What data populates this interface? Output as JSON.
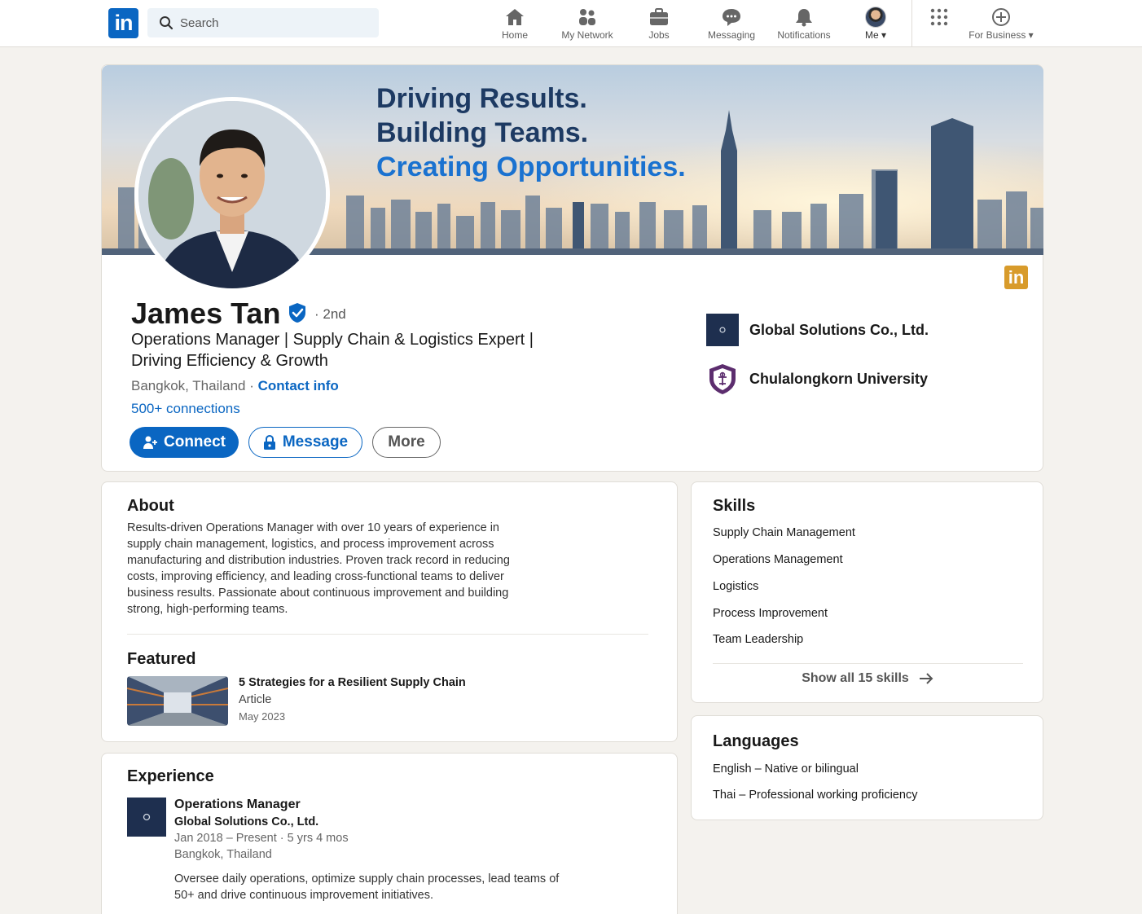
{
  "nav": {
    "logo": "in",
    "search_placeholder": "Search",
    "items": [
      {
        "label": "Home",
        "icon": "home-icon"
      },
      {
        "label": "My Network",
        "icon": "network-icon"
      },
      {
        "label": "Jobs",
        "icon": "briefcase-icon"
      },
      {
        "label": "Messaging",
        "icon": "messaging-icon"
      },
      {
        "label": "Notifications",
        "icon": "bell-icon"
      },
      {
        "label": "Me",
        "icon": "avatar"
      },
      {
        "label": "For Business",
        "icon": "grid-icon"
      }
    ],
    "accent": "#0a66c2"
  },
  "profile": {
    "banner_lines": [
      "Driving Results.",
      "Building Teams.",
      "Creating Opportunities."
    ],
    "name": "James Tan",
    "degree": "· 2nd",
    "headline": "Operations Manager | Supply Chain & Logistics Expert | Driving Efficiency & Growth",
    "location": "Bangkok, Thailand ·",
    "contact_info": "Contact info",
    "connections": "500+ connections",
    "buttons": {
      "connect": "Connect",
      "message": "Message",
      "more": "More"
    },
    "badge": "in",
    "badge_color": "#d89b2b",
    "company": "Global Solutions Co., Ltd.",
    "education": "Chulalongkorn University"
  },
  "about": {
    "title": "About",
    "text": "Results-driven Operations Manager with over 10 years of experience in supply chain management, logistics, and process improvement across manufacturing and distribution industries. Proven track record in reducing costs, improving efficiency, and leading cross-functional teams to deliver business results. Passionate about continuous improvement and building strong, high-performing teams."
  },
  "featured": {
    "title": "Featured",
    "item_title": "5 Strategies for a Resilient Supply Chain",
    "item_type": "Article",
    "item_date": "May 2023"
  },
  "skills": {
    "title": "Skills",
    "items": [
      "Supply Chain Management",
      "Operations Management",
      "Logistics",
      "Process Improvement",
      "Team Leadership"
    ],
    "show_all": "Show all 15 skills"
  },
  "languages": {
    "title": "Languages",
    "items": [
      "English – Native or bilingual",
      "Thai – Professional working proficiency"
    ]
  },
  "experience": {
    "title": "Experience",
    "role": "Operations Manager",
    "company": "Global Solutions Co., Ltd.",
    "dates": "Jan 2018 – Present · 5 yrs 4 mos",
    "location": "Bangkok, Thailand",
    "description": "Oversee daily operations, optimize supply chain processes, lead teams of 50+ and drive continuous improvement initiatives."
  }
}
